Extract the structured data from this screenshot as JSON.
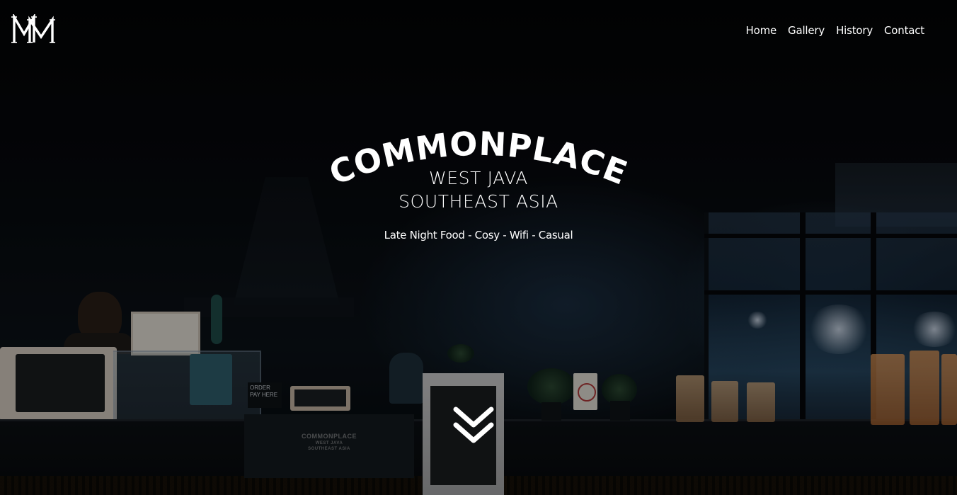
{
  "header": {
    "logo_icon": "monogram-logo",
    "nav": {
      "items": [
        {
          "label": "Home"
        },
        {
          "label": "Gallery"
        },
        {
          "label": "History"
        },
        {
          "label": "Contact"
        }
      ]
    }
  },
  "hero": {
    "brand": "COMMONPLACE",
    "line1": "WEST JAVA",
    "line2": "SOUTHEAST ASIA",
    "tagline": "Late Night Food - Cosy - Wifi - Casual",
    "scroll_icon": "double-chevron-down-icon"
  },
  "background": {
    "counter_logo_brand": "COMMONPLACE",
    "counter_logo_line1": "WEST JAVA",
    "counter_logo_line2": "SOUTHEAST ASIA",
    "order_sign": "ORDER PAY HERE"
  },
  "colors": {
    "text": "#ffffff",
    "background": "#05070a"
  }
}
